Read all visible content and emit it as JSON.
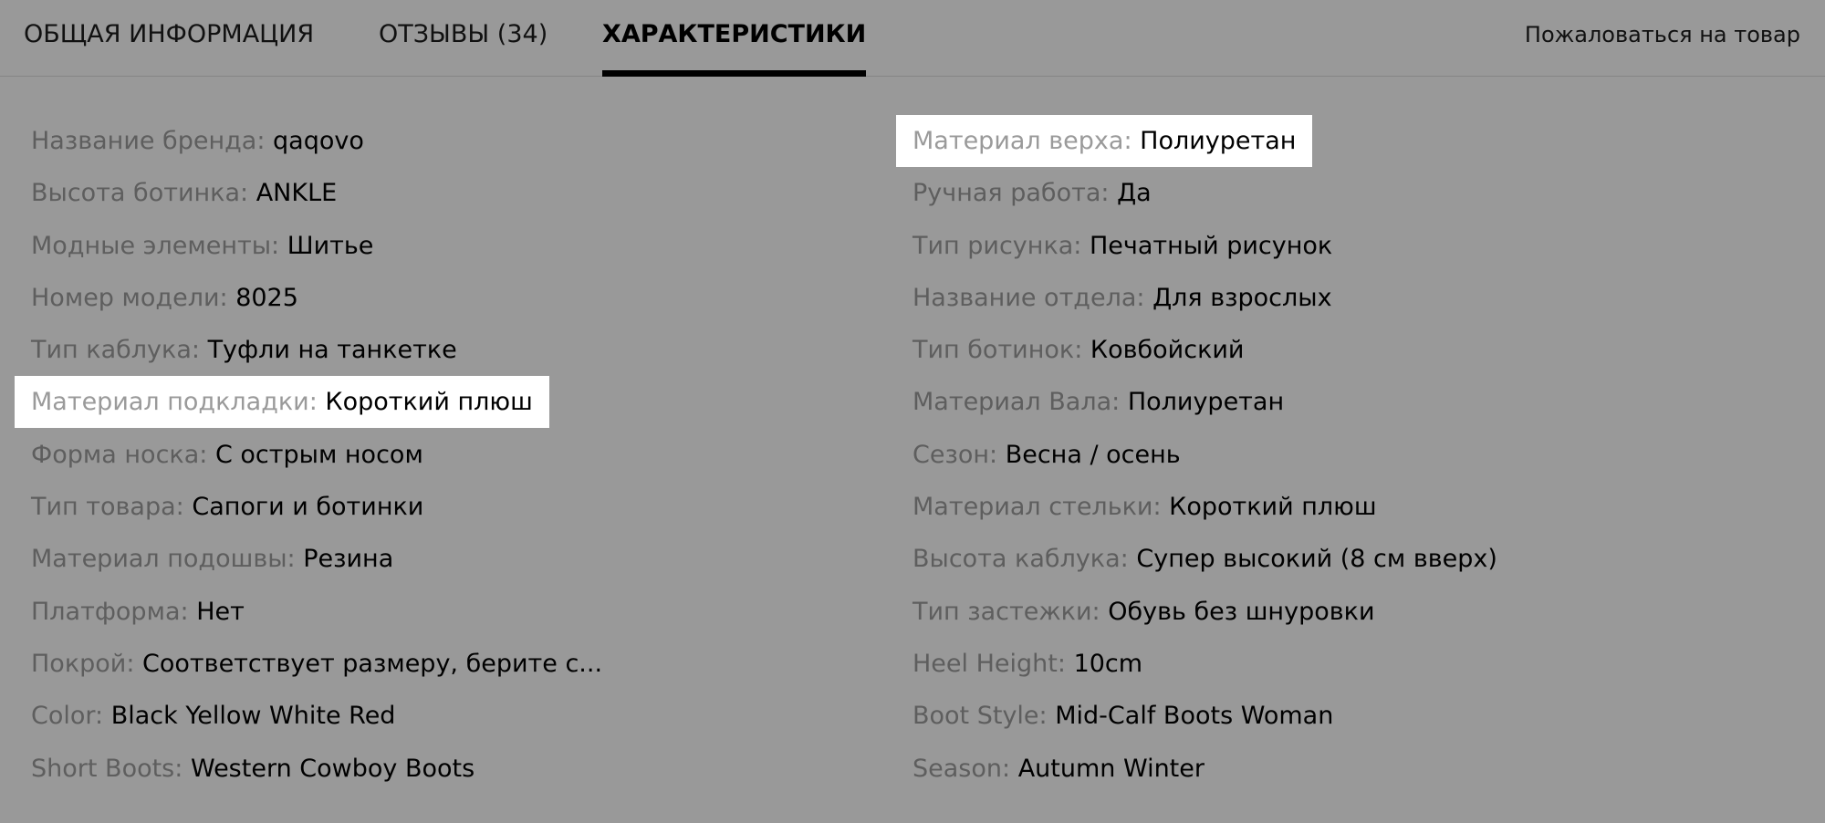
{
  "tabs": [
    {
      "label": "ОБЩАЯ ИНФОРМАЦИЯ",
      "active": false
    },
    {
      "label": "ОТЗЫВЫ (34)",
      "active": false
    },
    {
      "label": "ХАРАКТЕРИСТИКИ",
      "active": true
    }
  ],
  "report_link": "Пожаловаться на товар",
  "specs_left": [
    {
      "label": "Название бренда:",
      "value": "qaqovo",
      "highlighted": false
    },
    {
      "label": "Высота ботинка:",
      "value": "ANKLE",
      "highlighted": false
    },
    {
      "label": "Модные элементы:",
      "value": "Шитье",
      "highlighted": false
    },
    {
      "label": "Номер модели:",
      "value": "8025",
      "highlighted": false
    },
    {
      "label": "Тип каблука:",
      "value": "Туфли на танкетке",
      "highlighted": false
    },
    {
      "label": "Материал подкладки:",
      "value": "Короткий плюш",
      "highlighted": true
    },
    {
      "label": "Форма носка:",
      "value": "С острым носом",
      "highlighted": false
    },
    {
      "label": "Тип товара:",
      "value": "Сапоги и ботинки",
      "highlighted": false
    },
    {
      "label": "Материал подошвы:",
      "value": "Резина",
      "highlighted": false
    },
    {
      "label": "Платформа:",
      "value": "Нет",
      "highlighted": false
    },
    {
      "label": "Покрой:",
      "value": "Соответствует размеру, берите с...",
      "highlighted": false
    },
    {
      "label": "Color:",
      "value": "Black Yellow White Red",
      "highlighted": false
    },
    {
      "label": "Short Boots:",
      "value": "Western Cowboy Boots",
      "highlighted": false
    }
  ],
  "specs_right": [
    {
      "label": "Материал верха:",
      "value": "Полиуретан",
      "highlighted": true
    },
    {
      "label": "Ручная работа:",
      "value": "Да",
      "highlighted": false
    },
    {
      "label": "Тип рисунка:",
      "value": "Печатный рисунок",
      "highlighted": false
    },
    {
      "label": "Название отдела:",
      "value": "Для взрослых",
      "highlighted": false
    },
    {
      "label": "Тип ботинок:",
      "value": "Ковбойский",
      "highlighted": false
    },
    {
      "label": "Материал Вала:",
      "value": "Полиуретан",
      "highlighted": false
    },
    {
      "label": "Сезон:",
      "value": "Весна / осень",
      "highlighted": false
    },
    {
      "label": "Материал стельки:",
      "value": "Короткий плюш",
      "highlighted": false
    },
    {
      "label": "Высота каблука:",
      "value": "Супер высокий (8 см вверх)",
      "highlighted": false
    },
    {
      "label": "Тип застежки:",
      "value": "Обувь без шнуровки",
      "highlighted": false
    },
    {
      "label": "Heel Height:",
      "value": "10cm",
      "highlighted": false
    },
    {
      "label": "Boot Style:",
      "value": "Mid-Calf Boots Woman",
      "highlighted": false
    },
    {
      "label": "Season:",
      "value": "Autumn Winter",
      "highlighted": false
    }
  ],
  "colors": {
    "background": "#999999",
    "label": "#5e5e5e",
    "value": "#000000",
    "highlight": "#ffffff",
    "active_tab_underline": "#000000"
  }
}
